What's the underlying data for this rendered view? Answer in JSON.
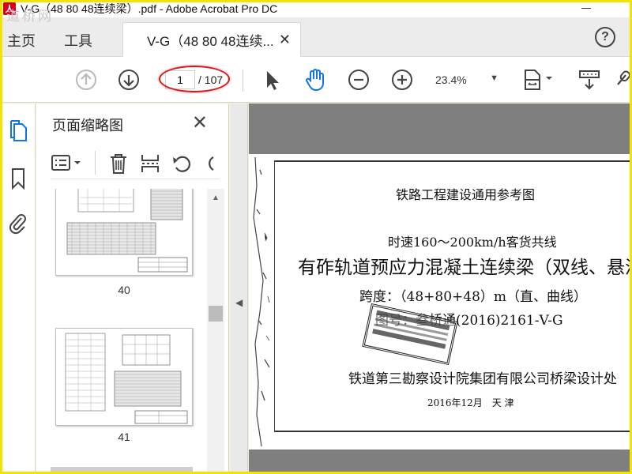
{
  "window": {
    "title": "V-G（48 80 48连续梁）.pdf - Adobe Acrobat Pro DC",
    "app_icon_glyph": "人",
    "watermark": "道桥网"
  },
  "tabs": {
    "home": "主页",
    "tools": "工具",
    "document": "V-G（48 80 48连续...",
    "close": "✕"
  },
  "help": "?",
  "toolbar": {
    "page_current": "1",
    "page_total": "/ 107",
    "zoom": "23.4%",
    "icons": [
      "prev-page-icon",
      "next-page-icon",
      "select-arrow-icon",
      "hand-icon",
      "zoom-out-icon",
      "zoom-in-icon",
      "page-fit-icon",
      "scroll-mode-icon",
      "link-icon"
    ]
  },
  "panel": {
    "title": "页面缩略图",
    "close": "✕",
    "thumbnails": [
      {
        "label": "40"
      },
      {
        "label": "41"
      }
    ]
  },
  "document": {
    "line1": "铁路工程建设通用参考图",
    "line2": "时速160～200km/h客货共线",
    "line3": "有砟轨道预应力混凝土连续梁（双线、悬浇",
    "line4": "跨度：（48+80+48）m（直、曲线）",
    "line5": "图号：叁桥通(2016)2161-V-G",
    "line6": "铁道第三勘察设计院集团有限公司桥梁设计处",
    "line7": "2016年12月　天 津"
  },
  "colors": {
    "frame": "#f2e300",
    "annotation": "#d9181b",
    "accent": "#1473e6"
  }
}
